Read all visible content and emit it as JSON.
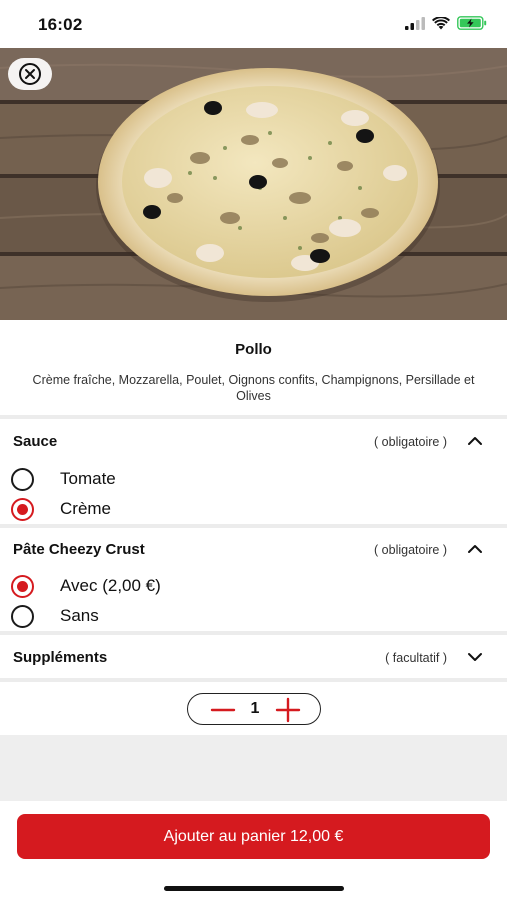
{
  "status_bar": {
    "time": "16:02",
    "icons": [
      "cellular-signal-icon",
      "wifi-icon",
      "battery-charging-icon"
    ],
    "battery_color": "#34c759"
  },
  "hero": {
    "image": "pizza-photo",
    "close_icon": "close-circle-icon"
  },
  "product": {
    "title": "Pollo",
    "description": "Crème fraîche, Mozzarella, Poulet, Oignons confits, Champignons, Persillade et Olives"
  },
  "sections": [
    {
      "title": "Sauce",
      "requirement": "( obligatoire )",
      "expanded": true,
      "chevron": "chevron-up-icon",
      "options": [
        {
          "label": "Tomate",
          "selected": false
        },
        {
          "label": "Crème",
          "selected": true
        }
      ]
    },
    {
      "title": "Pâte Cheezy Crust",
      "requirement": "( obligatoire )",
      "expanded": true,
      "chevron": "chevron-up-icon",
      "options": [
        {
          "label": "Avec (2,00 €)",
          "selected": true
        },
        {
          "label": "Sans",
          "selected": false
        }
      ]
    },
    {
      "title": "Suppléments",
      "requirement": "( facultatif )",
      "expanded": false,
      "chevron": "chevron-down-icon",
      "options": []
    }
  ],
  "quantity": {
    "value": "1",
    "minus_icon": "minus-icon",
    "plus_icon": "plus-icon"
  },
  "cta": {
    "label": "Ajouter au panier 12,00 €"
  },
  "colors": {
    "accent": "#d51a1f",
    "divider": "#ececec",
    "footer_grey": "#eeeeee"
  }
}
